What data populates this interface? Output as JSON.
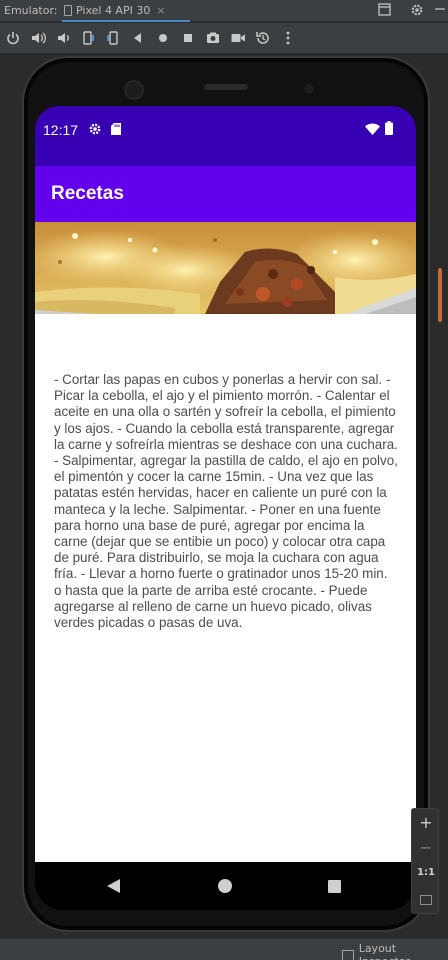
{
  "ide": {
    "panel_title": "Emulator:",
    "device_tab": "Pixel 4 API 30",
    "tab_close": "×",
    "layout_inspector": "Layout Inspector",
    "toolbar_icons": [
      "power-icon",
      "volume-up-icon",
      "volume-down-icon",
      "rotate-left-icon",
      "rotate-right-icon",
      "back-icon",
      "home-icon",
      "overview-icon",
      "screenshot-icon",
      "screen-record-icon",
      "snapshot-icon",
      "more-icon"
    ]
  },
  "zoom": {
    "zoom_in": "+",
    "zoom_out": "−",
    "one_to_one": "1:1"
  },
  "device": {
    "status": {
      "time": "12:17"
    },
    "app": {
      "title": "Recetas",
      "recipe_text": "- Cortar las papas en cubos y ponerlas a hervir con sal. - Picar la cebolla, el ajo y el pimiento morrón. - Calentar el aceite en una olla o sartén y sofreír la cebolla, el pimiento y los ajos. - Cuando la cebolla está transparente, agregar la carne y sofreírla mientras se deshace con una cuchara. - Salpimentar, agregar la pastilla de caldo, el ajo en polvo, el pimentón y cocer la carne 15min. - Una vez que las patatas estén hervidas, hacer en caliente un puré con la manteca y la leche. Salpimentar. - Poner en una fuente para horno una base de puré, agregar por encima la carne (dejar que se entibie un poco) y colocar otra capa de puré. Para distribuirlo, se moja la cuchara con agua fría. - Llevar a horno fuerte o gratinador unos 15-20 min. o hasta que la parte de arriba esté crocante. - Puede agregarse al relleno de carne un huevo picado, olivas verdes picadas o pasas de uva."
    },
    "colors": {
      "status_bar": "#3700b3",
      "app_bar": "#6200ee",
      "content_bg": "#ffffff"
    }
  }
}
